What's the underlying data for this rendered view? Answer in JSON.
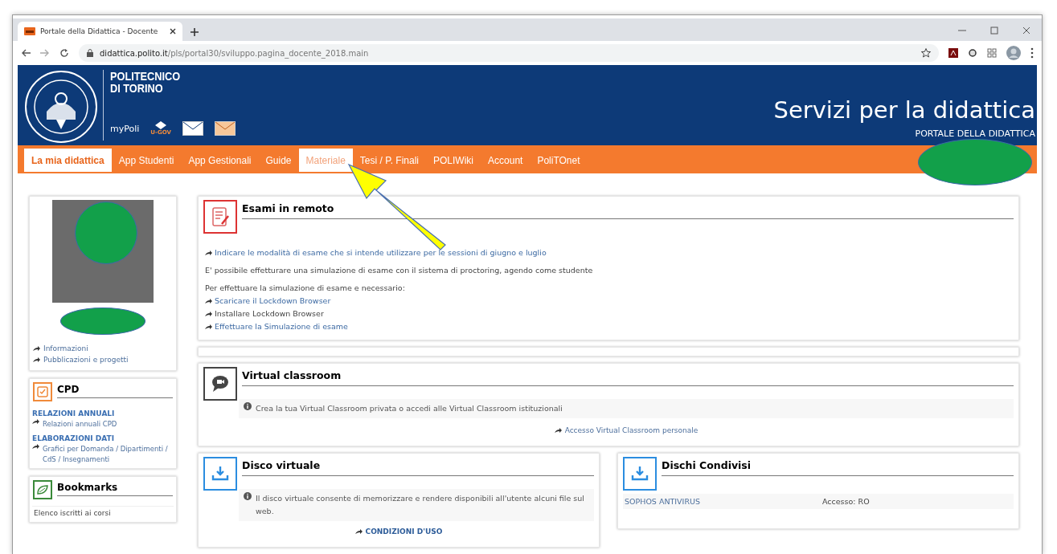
{
  "browser": {
    "tab_title": "Portale della Didattica - Docente",
    "url_host": "didattica.polito.it",
    "url_path": "/pls/portal30/sviluppo.pagina_docente_2018.main"
  },
  "header": {
    "logo_lines": [
      "POLITECNICO",
      "DI TORINO"
    ],
    "mypoli": "myPoli",
    "ugov": "U-GOV",
    "title": "Servizi per la didattica",
    "subtitle": "PORTALE DELLA DIDATTICA"
  },
  "nav": [
    {
      "label": "La mia didattica",
      "selected": true,
      "hovered": false
    },
    {
      "label": "App Studenti",
      "selected": false,
      "hovered": false
    },
    {
      "label": "App Gestionali",
      "selected": false,
      "hovered": false
    },
    {
      "label": "Guide",
      "selected": false,
      "hovered": false
    },
    {
      "label": "Materiale",
      "selected": false,
      "hovered": true
    },
    {
      "label": "Tesi / P. Finali",
      "selected": false,
      "hovered": false
    },
    {
      "label": "POLIWiki",
      "selected": false,
      "hovered": false
    },
    {
      "label": "Account",
      "selected": false,
      "hovered": false
    },
    {
      "label": "PoliTOnet",
      "selected": false,
      "hovered": false
    }
  ],
  "profile": {
    "links": [
      "Informazioni",
      "Pubblicazioni e progetti"
    ]
  },
  "side_cards": [
    {
      "title": "CPD",
      "sections": [
        {
          "heading": "RELAZIONI ANNUALI",
          "links": [
            "Relazioni annuali CPD"
          ]
        },
        {
          "heading": "ELABORAZIONI DATI",
          "links": [
            "Grafici per Domanda / Dipartimenti / CdS / Insegnamenti"
          ]
        }
      ]
    },
    {
      "title": "Bookmarks",
      "items": [
        "Elenco iscritti ai corsi"
      ]
    }
  ],
  "exam_card": {
    "title": "Esami in remoto",
    "lines": [
      {
        "kind": "link",
        "text": "Indicare le modalità di esame che si intende utilizzare per le sessioni di giugno e luglio"
      },
      {
        "kind": "text",
        "text": "E' possibile effetturare una simulazione di esame con il sistema di proctoring, agendo come studente"
      },
      {
        "kind": "text",
        "text": "Per effettuare la simulazione di esame e necessario:"
      },
      {
        "kind": "link",
        "text": "Scaricare il Lockdown Browser"
      },
      {
        "kind": "step",
        "text": "Installare Lockdown Browser"
      },
      {
        "kind": "link",
        "text": "Effettuare la Simulazione di esame"
      }
    ]
  },
  "classroom_card": {
    "title": "Virtual classroom",
    "info": "Crea la tua Virtual Classroom privata o accedi alle Virtual Classroom istituzionali",
    "link": "Accesso Virtual Classroom personale"
  },
  "disk_card": {
    "title": "Disco virtuale",
    "info": "Il disco virtuale consente di memorizzare e rendere disponibili all'utente alcuni file sul web.",
    "link": "CONDIZIONI D'USO"
  },
  "shared_card": {
    "title": "Dischi Condivisi",
    "rows": [
      {
        "name": "SOPHOS ANTIVIRUS",
        "access": "Accesso: RO"
      }
    ]
  }
}
